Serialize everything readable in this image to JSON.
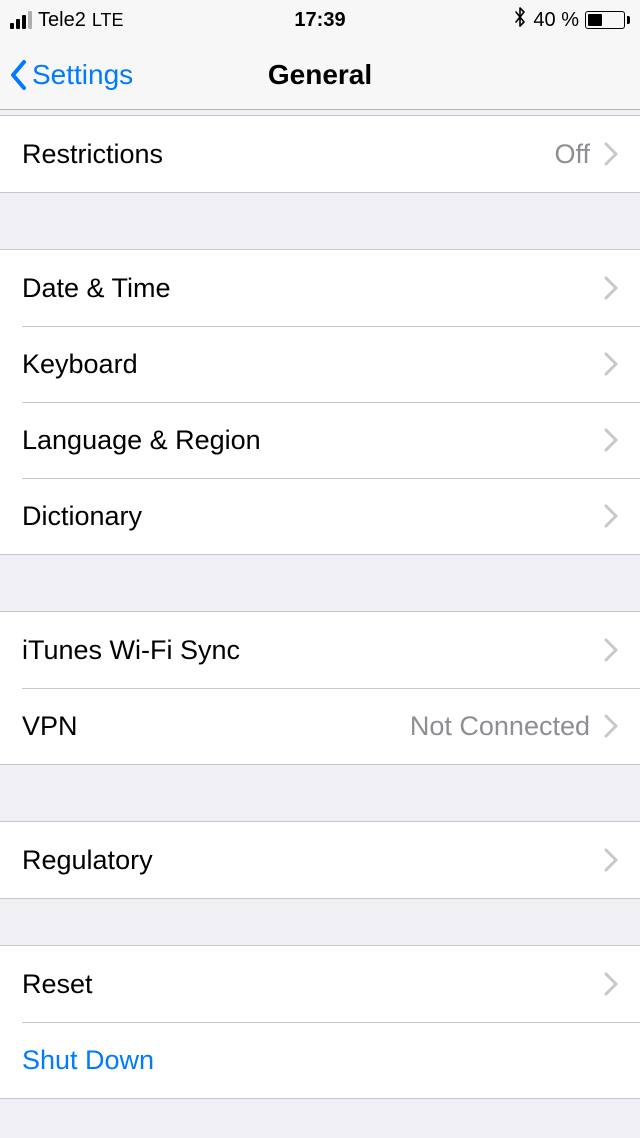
{
  "status": {
    "carrier": "Tele2",
    "network": "LTE",
    "time": "17:39",
    "battery_pct": "40 %"
  },
  "nav": {
    "back_label": "Settings",
    "title": "General"
  },
  "rows": {
    "restrictions": {
      "label": "Restrictions",
      "value": "Off"
    },
    "date_time": {
      "label": "Date & Time"
    },
    "keyboard": {
      "label": "Keyboard"
    },
    "language_region": {
      "label": "Language & Region"
    },
    "dictionary": {
      "label": "Dictionary"
    },
    "itunes_wifi": {
      "label": "iTunes Wi-Fi Sync"
    },
    "vpn": {
      "label": "VPN",
      "value": "Not Connected"
    },
    "regulatory": {
      "label": "Regulatory"
    },
    "reset": {
      "label": "Reset"
    },
    "shut_down": {
      "label": "Shut Down"
    }
  }
}
